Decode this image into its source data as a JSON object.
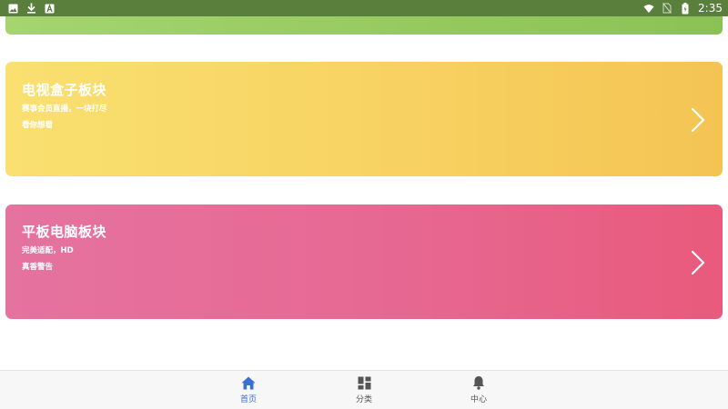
{
  "status_bar": {
    "time": "2:35",
    "left_icons": [
      "image-icon",
      "download-icon",
      "text-a-icon"
    ],
    "right_icons": [
      "wifi-icon",
      "no-sim-icon",
      "battery-icon"
    ],
    "background": "#5a7f3c"
  },
  "cards": [
    {
      "id": "tv-box",
      "title": "电视盒子板块",
      "line1": "赛事会员直播，一块打尽",
      "line2": "看你想看",
      "color_start": "#f9e070",
      "color_end": "#f4c453"
    },
    {
      "id": "tablet",
      "title": "平板电脑板块",
      "line1": "完美适配，HD",
      "line2": "真香警告",
      "color_start": "#e5739f",
      "color_end": "#e95a7c"
    }
  ],
  "top_card": {
    "color": "#95c95e"
  },
  "bottom_nav": {
    "items": [
      {
        "label": "首页",
        "icon": "home-icon",
        "active": true
      },
      {
        "label": "分类",
        "icon": "grid-icon",
        "active": false
      },
      {
        "label": "中心",
        "icon": "bell-icon",
        "active": false
      }
    ],
    "active_color": "#3b6fd1",
    "inactive_color": "#555555"
  }
}
